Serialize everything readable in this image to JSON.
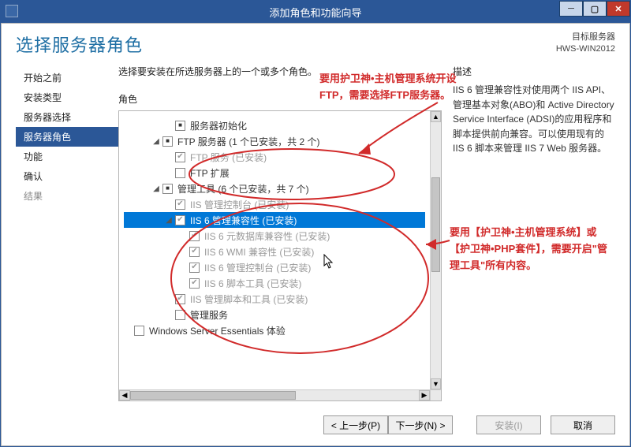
{
  "window": {
    "title": "添加角色和功能向导",
    "min_tip": "─",
    "max_tip": "▢",
    "close_tip": "✕"
  },
  "header": {
    "page_title": "选择服务器角色",
    "target_label": "目标服务器",
    "target_value": "HWS-WIN2012"
  },
  "sidebar": {
    "items": [
      {
        "label": "开始之前",
        "enabled": true
      },
      {
        "label": "安装类型",
        "enabled": true
      },
      {
        "label": "服务器选择",
        "enabled": true
      },
      {
        "label": "服务器角色",
        "enabled": true,
        "selected": true
      },
      {
        "label": "功能",
        "enabled": true
      },
      {
        "label": "确认",
        "enabled": true
      },
      {
        "label": "结果",
        "enabled": false
      }
    ]
  },
  "center": {
    "instruction": "选择要安装在所选服务器上的一个或多个角色。",
    "section_head": "角色",
    "rows": [
      {
        "indent": 2,
        "cb": "mixed",
        "label": "服务器初始化",
        "faded": false,
        "dark": true
      },
      {
        "indent": 1,
        "expander": "◢",
        "cb": "mixed",
        "label": "FTP 服务器 (1 个已安装，共 2 个)",
        "dark": true
      },
      {
        "indent": 2,
        "cb": "chk",
        "label": "FTP 服务 (已安装)"
      },
      {
        "indent": 2,
        "cb": "empty",
        "label": "FTP 扩展",
        "dark": true
      },
      {
        "indent": 1,
        "expander": "◢",
        "cb": "mixed",
        "label": "管理工具 (6 个已安装，共 7 个)",
        "dark": true
      },
      {
        "indent": 2,
        "cb": "chk",
        "label": "IIS 管理控制台 (已安装)"
      },
      {
        "indent": 2,
        "expander": "◢",
        "cb": "chk",
        "label": "IIS 6 管理兼容性 (已安装)",
        "selected": true
      },
      {
        "indent": 3,
        "cb": "chk",
        "label": "IIS 6 元数据库兼容性 (已安装)"
      },
      {
        "indent": 3,
        "cb": "chk",
        "label": "IIS 6 WMI 兼容性 (已安装)"
      },
      {
        "indent": 3,
        "cb": "chk",
        "label": "IIS 6 管理控制台 (已安装)"
      },
      {
        "indent": 3,
        "cb": "chk",
        "label": "IIS 6 脚本工具 (已安装)"
      },
      {
        "indent": 2,
        "cb": "chk",
        "label": "IIS 管理脚本和工具 (已安装)"
      },
      {
        "indent": 2,
        "cb": "empty",
        "label": "管理服务",
        "dark": true
      },
      {
        "indent": 0,
        "cb": "empty",
        "label": "Windows Server Essentials 体验",
        "dark": true
      }
    ]
  },
  "right": {
    "section_head": "描述",
    "description": "IIS 6 管理兼容性对使用两个 IIS API、管理基本对象(ABO)和 Active Directory Service Interface (ADSI)的应用程序和脚本提供前向兼容。可以使用现有的 IIS 6 脚本来管理 IIS 7 Web 服务器。"
  },
  "buttons": {
    "prev": "< 上一步(P)",
    "next": "下一步(N) >",
    "install": "安装(I)",
    "cancel": "取消"
  },
  "annotations": {
    "top": "要用护卫神•主机管理系统开设FTP，需要选择FTP服务器。",
    "bottom": "要用【护卫神•主机管理系统】或【护卫神•PHP套件】，需要开启\"管理工具\"所有内容。"
  }
}
